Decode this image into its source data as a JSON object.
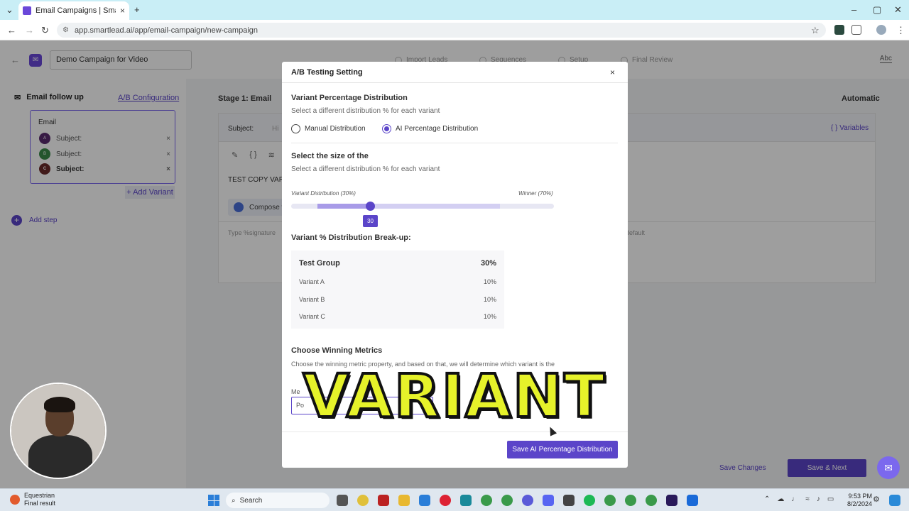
{
  "browser": {
    "tab_title": "Email Campaigns | Smartlead",
    "url": "app.smartlead.ai/app/email-campaign/new-campaign"
  },
  "topnav": {
    "campaign_name": "Demo Campaign for Video",
    "steps": [
      "Import Leads",
      "Sequences",
      "Setup",
      "Final Review"
    ],
    "right_label": "Abc"
  },
  "sidebar": {
    "heading": "Email follow up",
    "ab_config": "A/B Configuration",
    "email_title": "Email",
    "variants": [
      {
        "letter": "A",
        "label": "Subject:",
        "color": "#5a2a6e"
      },
      {
        "letter": "B",
        "label": "Subject:",
        "color": "#3a8a4a"
      },
      {
        "letter": "C",
        "label": "Subject:",
        "color": "#6a2a2a"
      }
    ],
    "add_variant": "+ Add Variant",
    "add_step": "Add step"
  },
  "editor": {
    "stage": "Stage 1: Email",
    "automatic": "Automatic",
    "subject_label": "Subject:",
    "subject_placeholder": "Hi",
    "variables": "{ } Variables",
    "body_text": "TEST COPY VARI",
    "compose": "Compose w",
    "sig_hint": "Type %signature",
    "default_hint": "default",
    "save_changes": "Save Changes",
    "save_next": "Save & Next"
  },
  "modal": {
    "title": "A/B Testing Setting",
    "section1_title": "Variant Percentage Distribution",
    "section1_sub": "Select a different distribution % for each variant",
    "radio_manual": "Manual Distribution",
    "radio_ai": "AI Percentage Distribution",
    "section2_title": "Select the size of the",
    "section2_sub": "Select a different distribution % for each variant",
    "slider_left": "Variant Distribution (30%)",
    "slider_right": "Winner (70%)",
    "slider_value": "30",
    "slider_fraction": 0.3,
    "breakup_title": "Variant % Distribution Break-up:",
    "breakup": {
      "group": "Test Group",
      "group_pct": "30%",
      "rows": [
        {
          "name": "Variant A",
          "pct": "10%"
        },
        {
          "name": "Variant B",
          "pct": "10%"
        },
        {
          "name": "Variant C",
          "pct": "10%"
        }
      ]
    },
    "winning_title": "Choose Winning Metrics",
    "winning_sub": "Choose the winning metric property, and based on that, we will determine which variant is the",
    "metric_label": "Me",
    "metric_value": "Po",
    "save_button": "Save AI Percentage Distribution",
    "close": "×"
  },
  "caption": "VARIANT",
  "taskbar": {
    "weather_title": "Equestrian",
    "weather_sub": "Final result",
    "search": "Search",
    "time": "9:53 PM",
    "date": "8/2/2024"
  }
}
